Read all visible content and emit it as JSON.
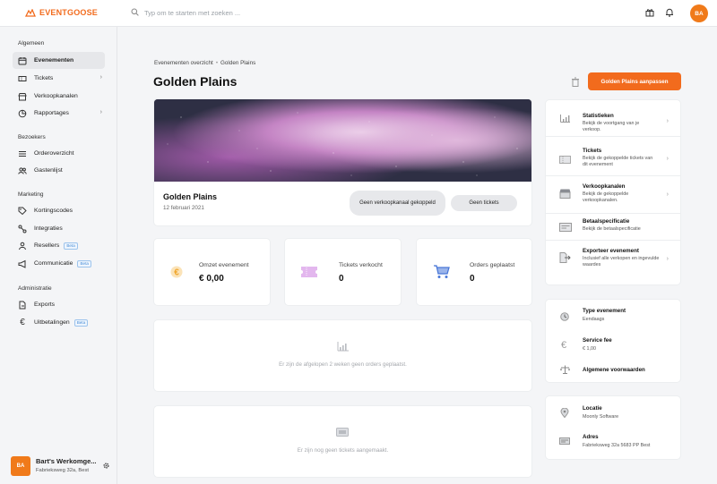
{
  "brand": {
    "name": "EVENTGOOSE",
    "accent": "#f26b1d"
  },
  "search": {
    "placeholder": "Typ om te starten met zoeken ..."
  },
  "top": {
    "avatar_initials": "BA"
  },
  "sidebar": {
    "sections": [
      {
        "title": "Algemeen"
      },
      {
        "title": "Bezoekers"
      },
      {
        "title": "Marketing"
      },
      {
        "title": "Administratie"
      }
    ],
    "items": [
      {
        "label": "Evenementen",
        "icon": "calendar-icon"
      },
      {
        "label": "Tickets",
        "icon": "ticket-icon"
      },
      {
        "label": "Verkoopkanalen",
        "icon": "store-icon"
      },
      {
        "label": "Rapportages",
        "icon": "pie-chart-icon"
      },
      {
        "label": "Orderoverzicht",
        "icon": "list-icon"
      },
      {
        "label": "Gastenlijst",
        "icon": "users-icon"
      },
      {
        "label": "Kortingscodes",
        "icon": "tag-icon"
      },
      {
        "label": "Integraties",
        "icon": "integration-icon"
      },
      {
        "label": "Resellers",
        "icon": "reseller-icon",
        "badge": "Beta"
      },
      {
        "label": "Communicatie",
        "icon": "megaphone-icon",
        "badge": "Beta"
      },
      {
        "label": "Exports",
        "icon": "export-icon"
      },
      {
        "label": "Uitbetalingen",
        "icon": "euro-icon",
        "badge": "Beta"
      }
    ],
    "user": {
      "initials": "BA",
      "name": "Bart's Werkomge...",
      "address": "Fabrieksweg 32a, Best"
    }
  },
  "breadcrumb": {
    "parent": "Evenementen overzicht",
    "separator": "•",
    "current": "Golden Plains"
  },
  "page": {
    "title": "Golden Plains",
    "primary_button": "Golden Plains aanpassen"
  },
  "event": {
    "name": "Golden Plains",
    "date": "12 februari 2021",
    "pill_channel": "Geen verkoopkanaal gekoppeld",
    "pill_tickets": "Geen tickets"
  },
  "stats": [
    {
      "label": "Omzet evenement",
      "value": "€ 0,00",
      "icon": "euro-coin-icon",
      "color": "#f0a52b"
    },
    {
      "label": "Tickets verkocht",
      "value": "0",
      "icon": "ticket-icon",
      "color": "#d9a6e6"
    },
    {
      "label": "Orders geplaatst",
      "value": "0",
      "icon": "cart-icon",
      "color": "#4a78d8"
    }
  ],
  "empty": {
    "orders": "Er zijn de afgelopen 2 weken geen orders geplaatst.",
    "tickets": "Er zijn nog geen tickets aangemaakt."
  },
  "links": [
    {
      "title": "Statistieken",
      "desc": "Bekijk de voortgang van je verkoop."
    },
    {
      "title": "Tickets",
      "desc": "Bekijk de gekoppelde tickets van dit evenement"
    },
    {
      "title": "Verkoopkanalen",
      "desc": "Bekijk de gekoppelde verkoopkanalen."
    },
    {
      "title": "Betaalspecificatie",
      "desc": "Bekijk de betaalspecificatie"
    },
    {
      "title": "Exporteer evenement",
      "desc": "Inclusief alle verkopen en ingevulde waardes"
    }
  ],
  "info": {
    "type_label": "Type evenement",
    "type_value": "Eendaags",
    "fee_label": "Service fee",
    "fee_value": "€ 1,00",
    "terms_label": "Algemene voorwaarden"
  },
  "location": {
    "loc_label": "Locatie",
    "loc_value": "Moonly Software",
    "addr_label": "Adres",
    "addr_value": "Fabrieksweg 32a 5683 PP Best"
  }
}
